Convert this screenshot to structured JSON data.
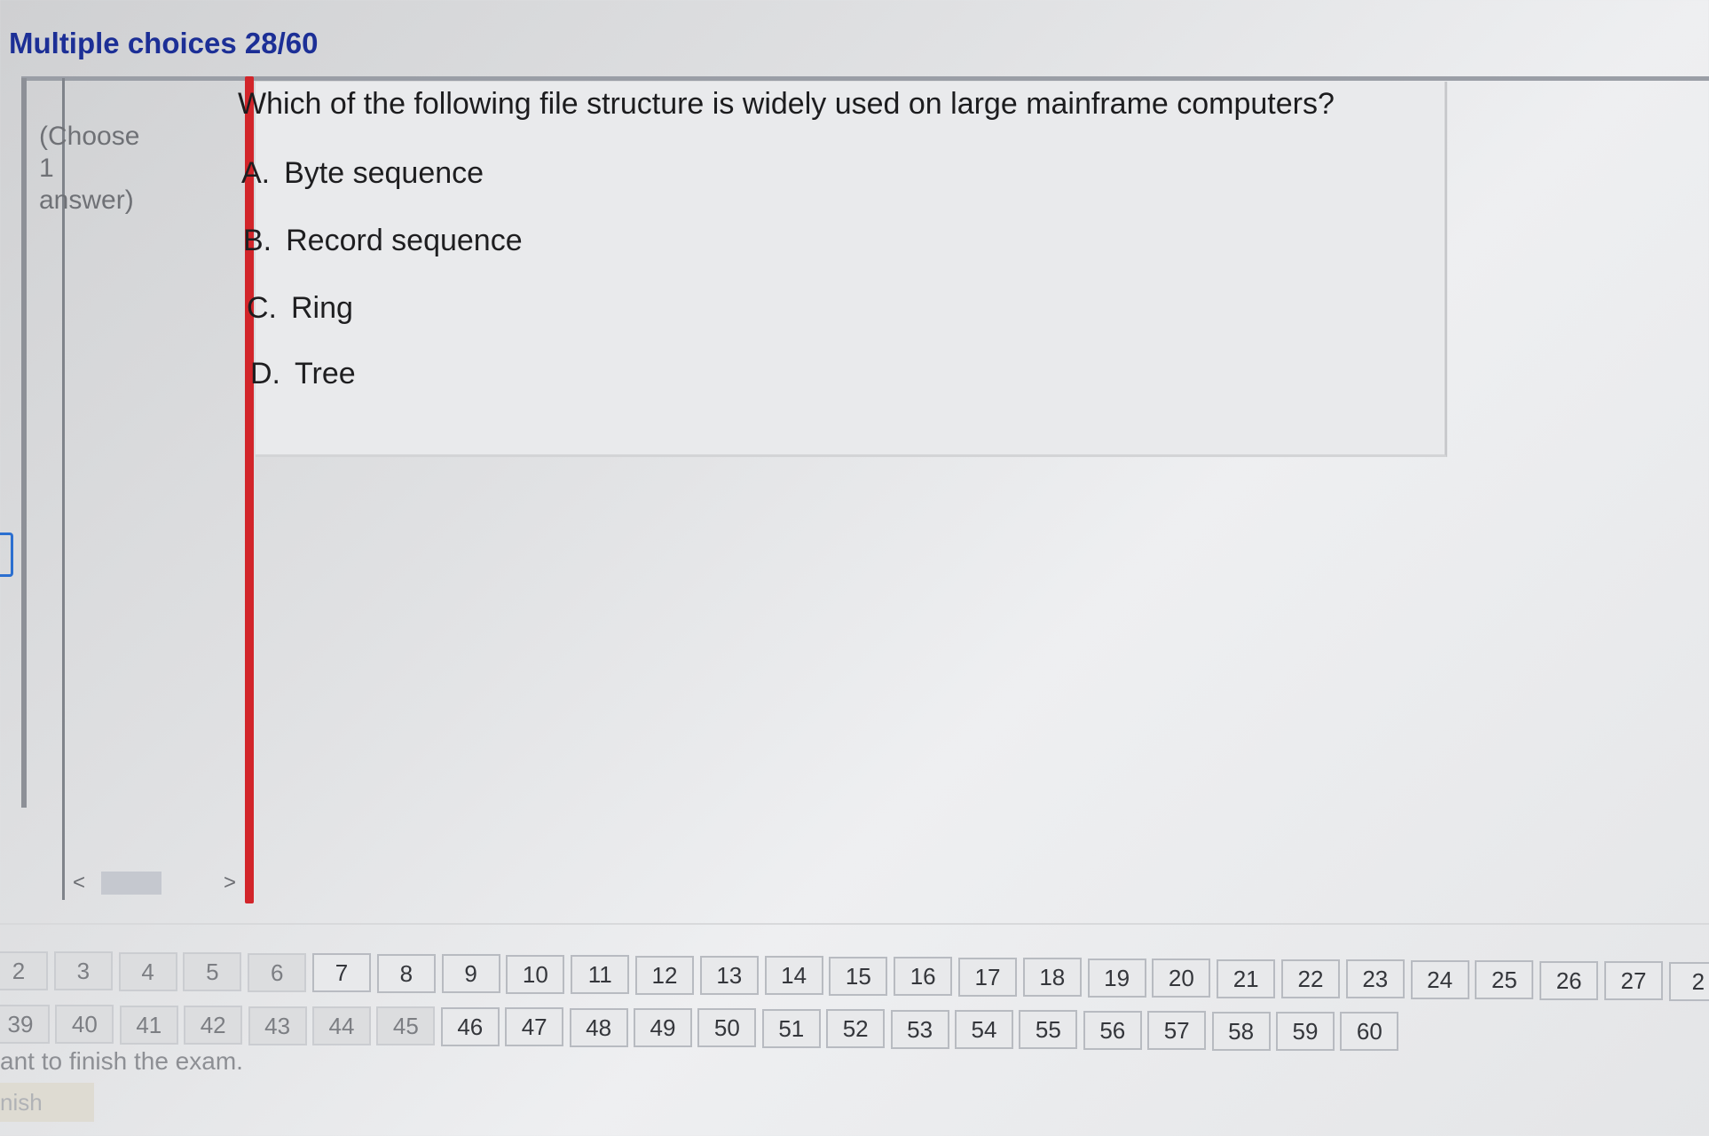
{
  "header": {
    "title": "Multiple choices 28/60"
  },
  "sidebar": {
    "instruction": "(Choose\n1\nanswer)"
  },
  "scrollbar": {
    "left_arrow": "<",
    "right_arrow": ">"
  },
  "question": {
    "text": "Which of the following file structure is widely used on large mainframe computers?",
    "options": [
      {
        "letter": "A.",
        "label": "Byte sequence"
      },
      {
        "letter": "B.",
        "label": "Record sequence"
      },
      {
        "letter": "C.",
        "label": "Ring"
      },
      {
        "letter": "D.",
        "label": "Tree"
      }
    ]
  },
  "navigation": {
    "row1": [
      "2",
      "3",
      "4",
      "5",
      "6",
      "7",
      "8",
      "9",
      "10",
      "11",
      "12",
      "13",
      "14",
      "15",
      "16",
      "17",
      "18",
      "19",
      "20",
      "21",
      "22",
      "23",
      "24",
      "25",
      "26",
      "27",
      "2"
    ],
    "row2": [
      "39",
      "40",
      "41",
      "42",
      "43",
      "44",
      "45",
      "46",
      "47",
      "48",
      "49",
      "50",
      "51",
      "52",
      "53",
      "54",
      "55",
      "56",
      "57",
      "58",
      "59",
      "60"
    ]
  },
  "footer": {
    "finish_prompt": "ant to finish the exam.",
    "finish_label": "nish"
  }
}
